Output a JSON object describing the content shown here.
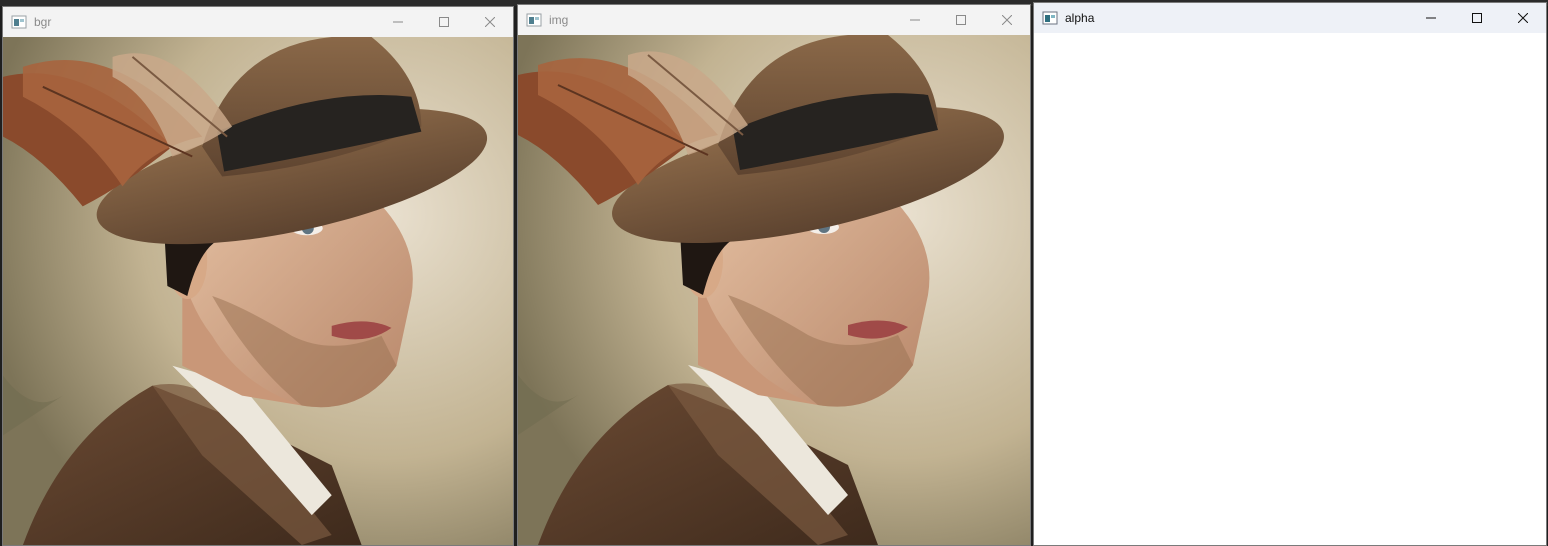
{
  "windows": [
    {
      "title": "bgr",
      "state": "inactive",
      "content": "photo"
    },
    {
      "title": "img",
      "state": "inactive",
      "content": "photo"
    },
    {
      "title": "alpha",
      "state": "active",
      "content": "blank"
    }
  ],
  "colors": {
    "titlebar_inactive": "#f3f3f3",
    "titlebar_active": "#eef1f7",
    "alpha_canvas": "#ffffff"
  }
}
